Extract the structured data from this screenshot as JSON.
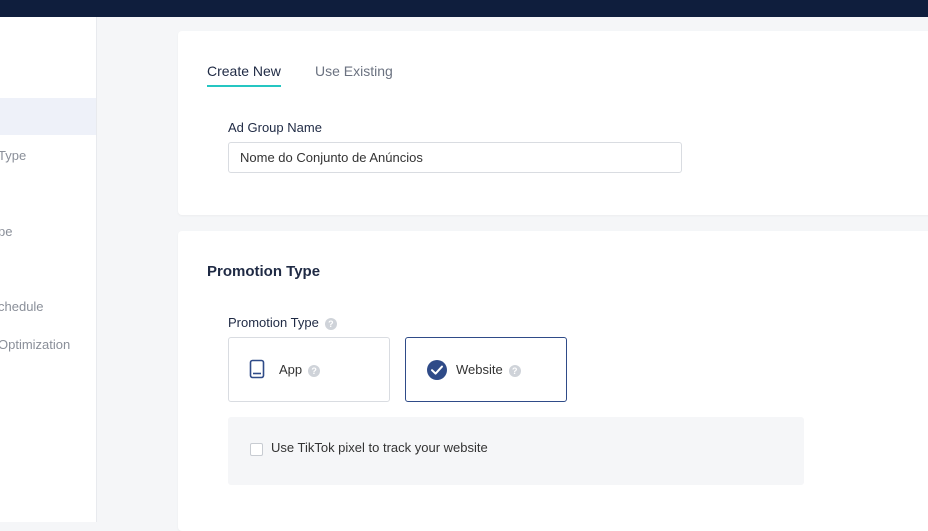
{
  "sidebar": {
    "items": [
      {
        "label": "Type"
      },
      {
        "label": "pe"
      },
      {
        "label": "chedule"
      },
      {
        "label": "Optimization"
      }
    ]
  },
  "ad_group": {
    "tabs": [
      {
        "label": "Create New",
        "active": true
      },
      {
        "label": "Use Existing",
        "active": false
      }
    ],
    "name_label": "Ad Group Name",
    "name_value": "Nome do Conjunto de Anúncios"
  },
  "promotion": {
    "section_title": "Promotion Type",
    "field_label": "Promotion Type",
    "options": [
      {
        "label": "App",
        "icon": "tablet-icon",
        "selected": false
      },
      {
        "label": "Website",
        "icon": "check-circle-icon",
        "selected": true
      }
    ],
    "pixel_checkbox_label": "Use TikTok pixel to track your website",
    "pixel_checked": false
  },
  "colors": {
    "topbar": "#0f1e3d",
    "accent_tab": "#25c6c2",
    "selected_border": "#2f4b88"
  }
}
